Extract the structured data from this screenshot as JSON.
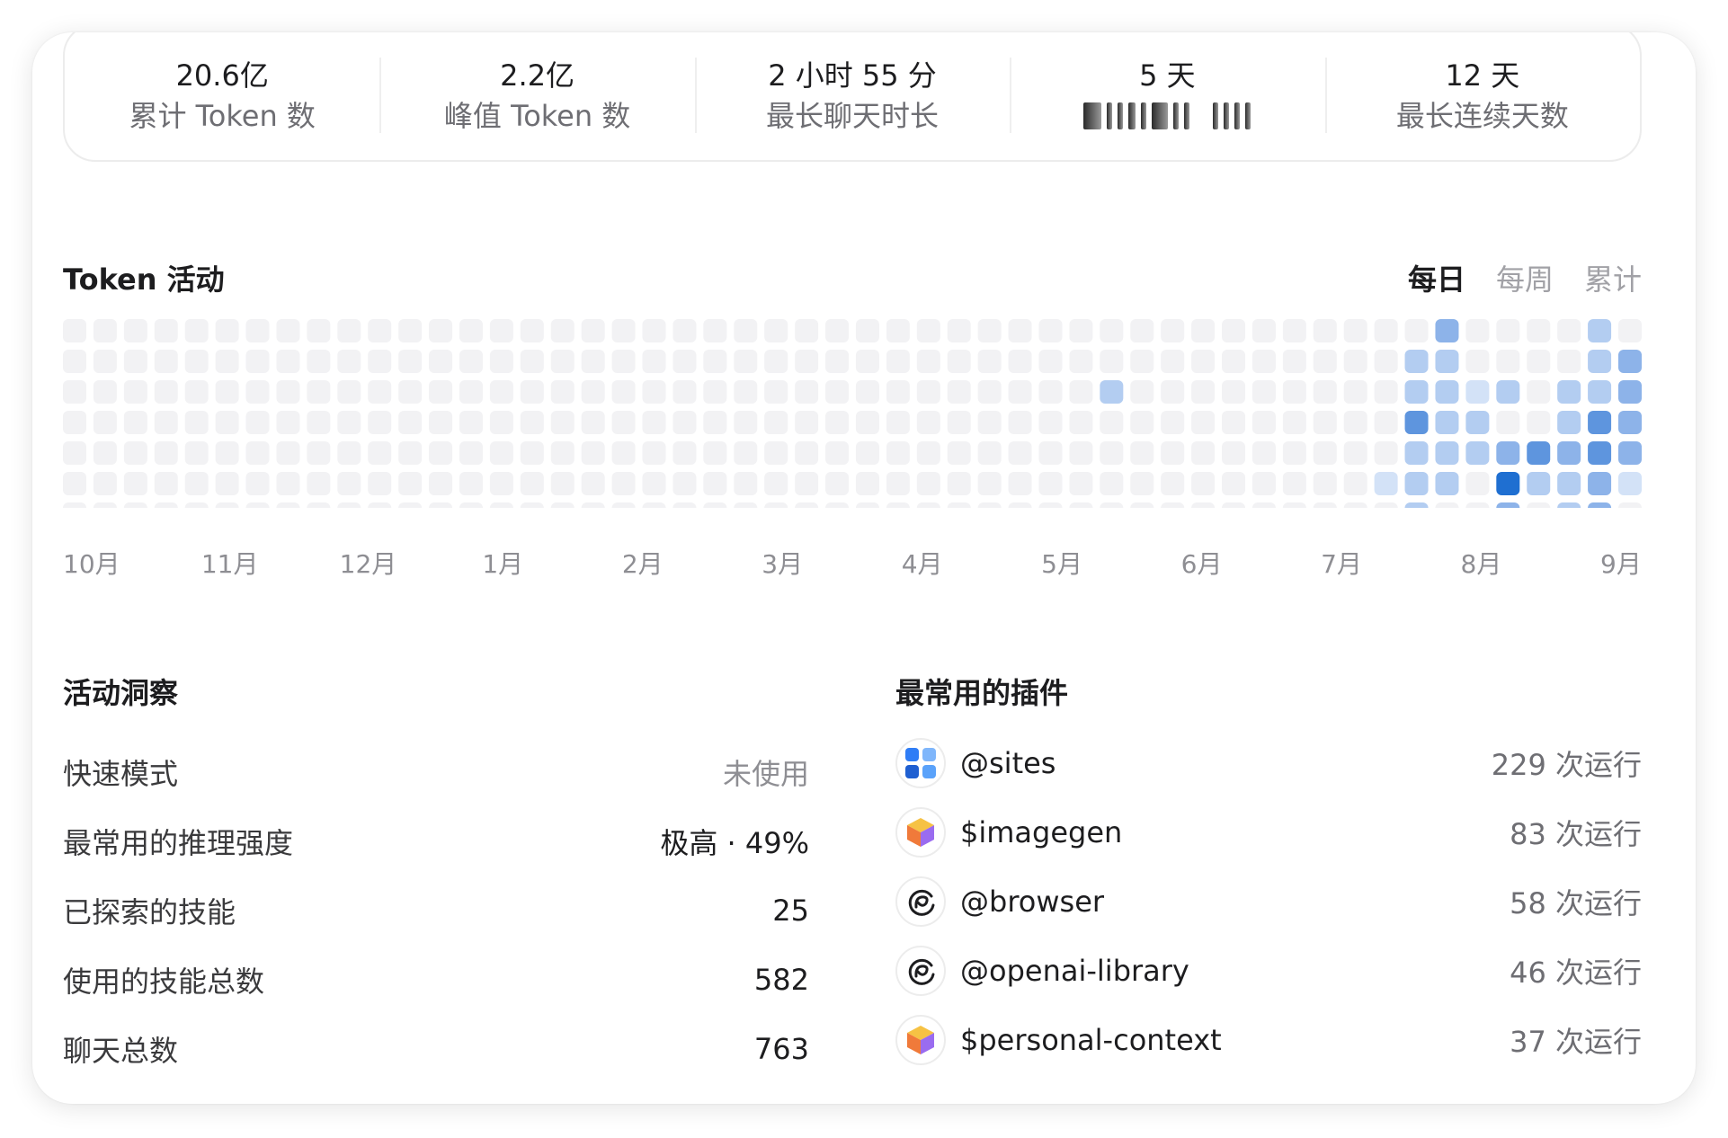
{
  "stats": [
    {
      "value": "20.6亿",
      "label": "累计 Token 数"
    },
    {
      "value": "2.2亿",
      "label": "峰值 Token 数"
    },
    {
      "value": "2 小时 55 分",
      "label": "最长聊天时长"
    },
    {
      "value": "5 天",
      "label": ""
    },
    {
      "value": "12 天",
      "label": "最长连续天数"
    }
  ],
  "activity": {
    "title": "Token 活动",
    "tabs": [
      {
        "label": "每日",
        "active": true
      },
      {
        "label": "每周",
        "active": false
      },
      {
        "label": "累计",
        "active": false
      }
    ],
    "months": [
      "10月",
      "11月",
      "12月",
      "1月",
      "2月",
      "3月",
      "4月",
      "5月",
      "6月",
      "7月",
      "8月",
      "9月"
    ],
    "empty_color": "#f2f2f4",
    "level_colors": [
      "#f2f2f4",
      "#d3e2f7",
      "#b3cdf1",
      "#8db3e9",
      "#5e95de",
      "#1f6fd1"
    ],
    "weeks": 52,
    "active_cells": [
      {
        "week": 34,
        "day": 2,
        "level": 2
      },
      {
        "week": 44,
        "day": 4,
        "level": 2
      },
      {
        "week": 44,
        "day": 5,
        "level": 2
      },
      {
        "week": 44,
        "day": 6,
        "level": 2
      },
      {
        "week": 45,
        "day": 0,
        "level": 3
      },
      {
        "week": 44,
        "day": 1,
        "level": 2
      },
      {
        "week": 45,
        "day": 1,
        "level": 2
      },
      {
        "week": 44,
        "day": 2,
        "level": 2
      },
      {
        "week": 45,
        "day": 2,
        "level": 2
      },
      {
        "week": 44,
        "day": 3,
        "level": 4
      },
      {
        "week": 45,
        "day": 3,
        "level": 2
      },
      {
        "week": 46,
        "day": 3,
        "level": 2
      },
      {
        "week": 45,
        "day": 4,
        "level": 2
      },
      {
        "week": 46,
        "day": 4,
        "level": 2
      },
      {
        "week": 43,
        "day": 5,
        "level": 1
      },
      {
        "week": 45,
        "day": 5,
        "level": 2
      },
      {
        "week": 46,
        "day": 2,
        "level": 1
      },
      {
        "week": 47,
        "day": 2,
        "level": 2
      },
      {
        "week": 47,
        "day": 4,
        "level": 3
      },
      {
        "week": 47,
        "day": 5,
        "level": 5
      },
      {
        "week": 47,
        "day": 6,
        "level": 3
      },
      {
        "week": 48,
        "day": 4,
        "level": 4
      },
      {
        "week": 48,
        "day": 5,
        "level": 2
      },
      {
        "week": 49,
        "day": 2,
        "level": 2
      },
      {
        "week": 49,
        "day": 3,
        "level": 2
      },
      {
        "week": 49,
        "day": 4,
        "level": 3
      },
      {
        "week": 49,
        "day": 5,
        "level": 2
      },
      {
        "week": 49,
        "day": 6,
        "level": 2
      },
      {
        "week": 50,
        "day": 0,
        "level": 2
      },
      {
        "week": 50,
        "day": 1,
        "level": 2
      },
      {
        "week": 50,
        "day": 2,
        "level": 2
      },
      {
        "week": 50,
        "day": 3,
        "level": 4
      },
      {
        "week": 50,
        "day": 4,
        "level": 4
      },
      {
        "week": 50,
        "day": 5,
        "level": 3
      },
      {
        "week": 50,
        "day": 6,
        "level": 3
      },
      {
        "week": 51,
        "day": 1,
        "level": 3
      },
      {
        "week": 51,
        "day": 2,
        "level": 3
      },
      {
        "week": 51,
        "day": 3,
        "level": 3
      },
      {
        "week": 51,
        "day": 4,
        "level": 3
      },
      {
        "week": 51,
        "day": 5,
        "level": 1
      }
    ]
  },
  "insights": {
    "title": "活动洞察",
    "rows": [
      {
        "label": "快速模式",
        "value": "未使用",
        "muted": true
      },
      {
        "label": "最常用的推理强度",
        "value": "极高 · 49%",
        "muted": false
      },
      {
        "label": "已探索的技能",
        "value": "25",
        "muted": false
      },
      {
        "label": "使用的技能总数",
        "value": "582",
        "muted": false
      },
      {
        "label": "聊天总数",
        "value": "763",
        "muted": false
      }
    ]
  },
  "plugins": {
    "title": "最常用的插件",
    "rows": [
      {
        "name": "@sites",
        "runs": "229 次运行",
        "icon": "sites-grid-icon"
      },
      {
        "name": "$imagegen",
        "runs": "83 次运行",
        "icon": "imagegen-cube-icon"
      },
      {
        "name": "@browser",
        "runs": "58 次运行",
        "icon": "browser-swirl-icon"
      },
      {
        "name": "@openai-library",
        "runs": "46 次运行",
        "icon": "library-swirl-icon"
      },
      {
        "name": "$personal-context",
        "runs": "37 次运行",
        "icon": "personal-context-cube-icon"
      }
    ]
  }
}
